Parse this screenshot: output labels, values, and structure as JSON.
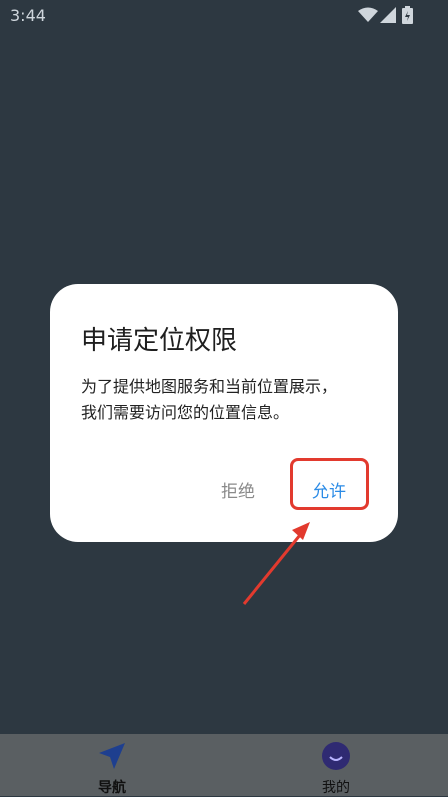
{
  "status": {
    "time": "3:44"
  },
  "dialog": {
    "title": "申请定位权限",
    "message_line1": "为了提供地图服务和当前位置展示，",
    "message_line2": "我们需要访问您的位置信息。",
    "deny_label": "拒绝",
    "allow_label": "允许"
  },
  "bottom_nav": {
    "items": [
      {
        "label": "导航",
        "icon": "navigation-arrow-icon"
      },
      {
        "label": "我的",
        "icon": "avatar-icon"
      }
    ]
  },
  "colors": {
    "background": "#2d3841",
    "dialog": "#ffffff",
    "accent": "#2b8be6",
    "annotation": "#e23a2e"
  }
}
